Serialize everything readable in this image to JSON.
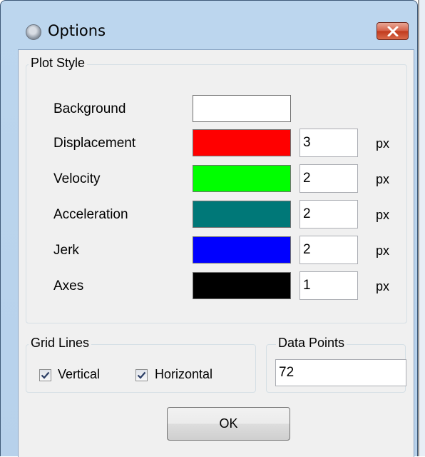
{
  "window": {
    "title": "Options"
  },
  "plot_style": {
    "label": "Plot Style",
    "rows": [
      {
        "label": "Background",
        "color": "#FFFFFF",
        "width": null,
        "unit": null
      },
      {
        "label": "Displacement",
        "color": "#FF0000",
        "width": "3",
        "unit": "px"
      },
      {
        "label": "Velocity",
        "color": "#00FF00",
        "width": "2",
        "unit": "px"
      },
      {
        "label": "Acceleration",
        "color": "#007878",
        "width": "2",
        "unit": "px"
      },
      {
        "label": "Jerk",
        "color": "#0000FF",
        "width": "2",
        "unit": "px"
      },
      {
        "label": "Axes",
        "color": "#000000",
        "width": "1",
        "unit": "px"
      }
    ]
  },
  "grid_lines": {
    "label": "Grid Lines",
    "vertical": {
      "label": "Vertical",
      "checked": true
    },
    "horizontal": {
      "label": "Horizontal",
      "checked": true
    }
  },
  "data_points": {
    "label": "Data Points",
    "value": "72"
  },
  "buttons": {
    "ok": "OK"
  }
}
